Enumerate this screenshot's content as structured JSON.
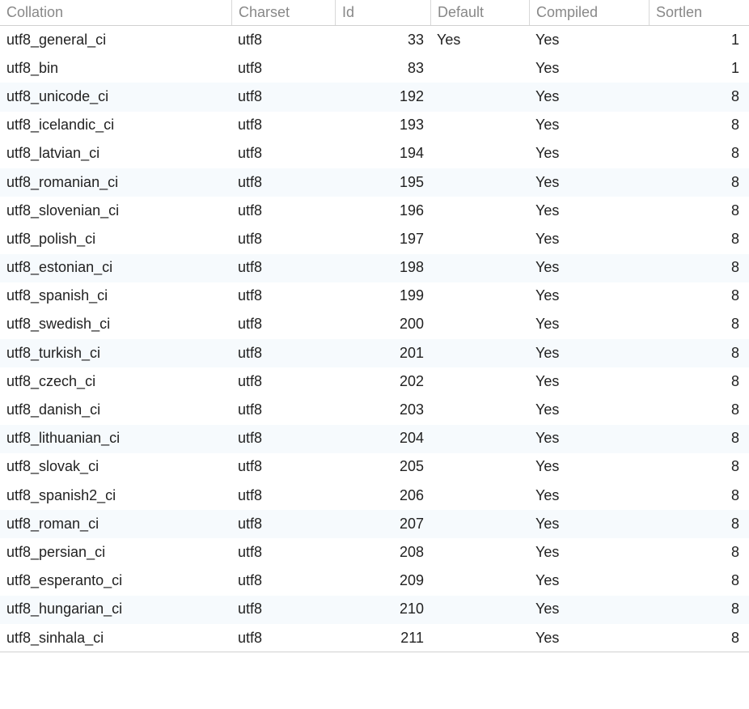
{
  "table": {
    "headers": {
      "collation": "Collation",
      "charset": "Charset",
      "id": "Id",
      "default": "Default",
      "compiled": "Compiled",
      "sortlen": "Sortlen"
    },
    "rows": [
      {
        "collation": "utf8_general_ci",
        "charset": "utf8",
        "id": "33",
        "default": "Yes",
        "compiled": "Yes",
        "sortlen": "1"
      },
      {
        "collation": "utf8_bin",
        "charset": "utf8",
        "id": "83",
        "default": "",
        "compiled": "Yes",
        "sortlen": "1"
      },
      {
        "collation": "utf8_unicode_ci",
        "charset": "utf8",
        "id": "192",
        "default": "",
        "compiled": "Yes",
        "sortlen": "8"
      },
      {
        "collation": "utf8_icelandic_ci",
        "charset": "utf8",
        "id": "193",
        "default": "",
        "compiled": "Yes",
        "sortlen": "8"
      },
      {
        "collation": "utf8_latvian_ci",
        "charset": "utf8",
        "id": "194",
        "default": "",
        "compiled": "Yes",
        "sortlen": "8"
      },
      {
        "collation": "utf8_romanian_ci",
        "charset": "utf8",
        "id": "195",
        "default": "",
        "compiled": "Yes",
        "sortlen": "8"
      },
      {
        "collation": "utf8_slovenian_ci",
        "charset": "utf8",
        "id": "196",
        "default": "",
        "compiled": "Yes",
        "sortlen": "8"
      },
      {
        "collation": "utf8_polish_ci",
        "charset": "utf8",
        "id": "197",
        "default": "",
        "compiled": "Yes",
        "sortlen": "8"
      },
      {
        "collation": "utf8_estonian_ci",
        "charset": "utf8",
        "id": "198",
        "default": "",
        "compiled": "Yes",
        "sortlen": "8"
      },
      {
        "collation": "utf8_spanish_ci",
        "charset": "utf8",
        "id": "199",
        "default": "",
        "compiled": "Yes",
        "sortlen": "8"
      },
      {
        "collation": "utf8_swedish_ci",
        "charset": "utf8",
        "id": "200",
        "default": "",
        "compiled": "Yes",
        "sortlen": "8"
      },
      {
        "collation": "utf8_turkish_ci",
        "charset": "utf8",
        "id": "201",
        "default": "",
        "compiled": "Yes",
        "sortlen": "8"
      },
      {
        "collation": "utf8_czech_ci",
        "charset": "utf8",
        "id": "202",
        "default": "",
        "compiled": "Yes",
        "sortlen": "8"
      },
      {
        "collation": "utf8_danish_ci",
        "charset": "utf8",
        "id": "203",
        "default": "",
        "compiled": "Yes",
        "sortlen": "8"
      },
      {
        "collation": "utf8_lithuanian_ci",
        "charset": "utf8",
        "id": "204",
        "default": "",
        "compiled": "Yes",
        "sortlen": "8"
      },
      {
        "collation": "utf8_slovak_ci",
        "charset": "utf8",
        "id": "205",
        "default": "",
        "compiled": "Yes",
        "sortlen": "8"
      },
      {
        "collation": "utf8_spanish2_ci",
        "charset": "utf8",
        "id": "206",
        "default": "",
        "compiled": "Yes",
        "sortlen": "8"
      },
      {
        "collation": "utf8_roman_ci",
        "charset": "utf8",
        "id": "207",
        "default": "",
        "compiled": "Yes",
        "sortlen": "8"
      },
      {
        "collation": "utf8_persian_ci",
        "charset": "utf8",
        "id": "208",
        "default": "",
        "compiled": "Yes",
        "sortlen": "8"
      },
      {
        "collation": "utf8_esperanto_ci",
        "charset": "utf8",
        "id": "209",
        "default": "",
        "compiled": "Yes",
        "sortlen": "8"
      },
      {
        "collation": "utf8_hungarian_ci",
        "charset": "utf8",
        "id": "210",
        "default": "",
        "compiled": "Yes",
        "sortlen": "8"
      },
      {
        "collation": "utf8_sinhala_ci",
        "charset": "utf8",
        "id": "211",
        "default": "",
        "compiled": "Yes",
        "sortlen": "8"
      }
    ],
    "alt_rows": [
      2,
      5,
      8,
      11,
      14,
      17,
      20
    ]
  }
}
